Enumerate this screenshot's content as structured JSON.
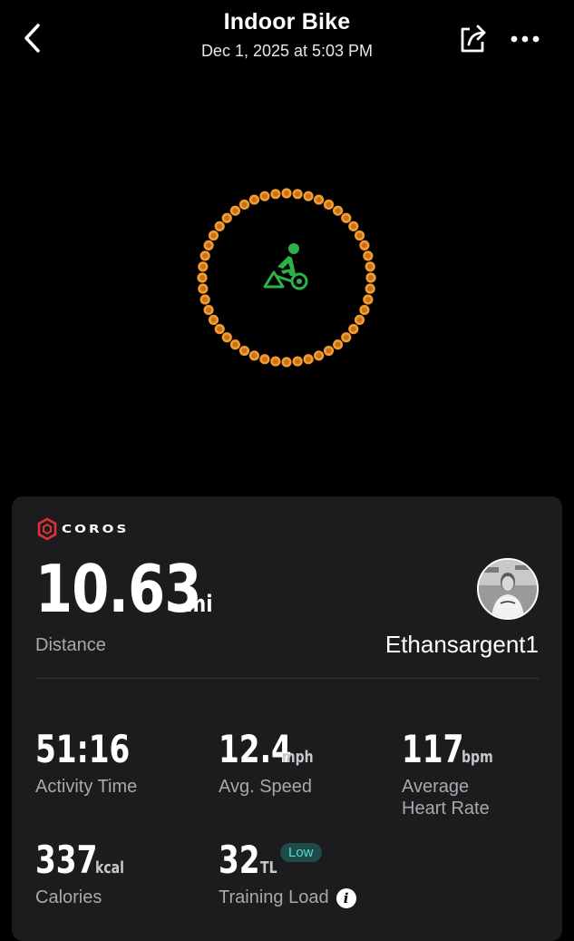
{
  "header": {
    "title": "Indoor Bike",
    "subtitle": "Dec 1, 2025 at 5:03 PM",
    "back_icon": "chevron-left-icon",
    "share_icon": "share-icon",
    "more_icon": "more-horizontal-icon"
  },
  "hero": {
    "icon": "indoor-bike-icon",
    "ring_color": "#f29b2f",
    "icon_color": "#2bb34a"
  },
  "card": {
    "brand": "COROS",
    "brand_color": "#e0303a",
    "distance": {
      "value": "10.63",
      "unit": "mi",
      "label": "Distance"
    },
    "user": {
      "name": "Ethansargent1"
    },
    "stats": [
      {
        "value": "51:16",
        "unit": "",
        "label": "Activity Time"
      },
      {
        "value": "12.4",
        "unit": "mph",
        "label": "Avg. Speed"
      },
      {
        "value": "117",
        "unit": "bpm",
        "label_line1": "Average",
        "label_line2": "Heart Rate"
      },
      {
        "value": "337",
        "unit": "kcal",
        "label": "Calories"
      },
      {
        "value": "32",
        "unit": "TL",
        "badge": "Low",
        "label": "Training Load",
        "info_icon": "info-icon"
      }
    ]
  }
}
